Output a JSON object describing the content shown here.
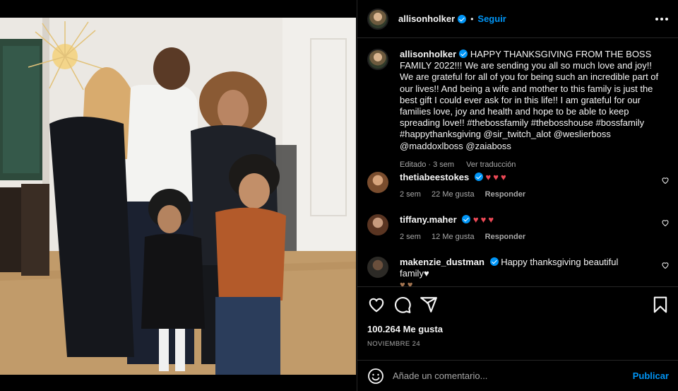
{
  "post": {
    "author": "allisonholker",
    "follow_label": "Seguir",
    "dot": "•",
    "caption": "HAPPY THANKSGIVING FROM THE BOSS FAMILY 2022!!! We are sending you all so much love and joy!! We are grateful for all of you for being such an incredible part of our lives!! And being a wife and mother to this family is just the best gift I could ever ask for in this life!! I am grateful for our families love, joy and health and hope to be able to keep spreading love!! #thebossfamily #thebosshouse #bossfamily #happythanksgiving @sir_twitch_alot @weslierboss @maddoxlboss @zaiaboss",
    "edited": "Editado · 3 sem",
    "translate": "Ver traducción",
    "likes": "100.264 Me gusta",
    "date": "NOVIEMBRE 24"
  },
  "comments": [
    {
      "user": "thetiabeestokes",
      "verified": true,
      "text": "♥♥♥",
      "time": "2 sem",
      "likes": "22 Me gusta",
      "reply": "Responder"
    },
    {
      "user": "tiffany.maher",
      "verified": true,
      "text": "♥♥♥",
      "time": "2 sem",
      "likes": "12 Me gusta",
      "reply": "Responder"
    },
    {
      "user": "makenzie_dustman",
      "verified": true,
      "text": "Happy thanksgiving beautiful family♥",
      "extra": "♥♥"
    }
  ],
  "composer": {
    "placeholder": "Añade un comentario...",
    "publish_label": "Publicar"
  },
  "colors": {
    "accent": "#0095f6",
    "background": "#000000",
    "muted": "#a8a8a8",
    "heart_red": "#ed4956",
    "heart_brown": "#a37450"
  },
  "icons": [
    "more-options-icon",
    "like-icon",
    "comment-icon",
    "share-icon",
    "save-icon",
    "emoji-icon",
    "small-heart-icon",
    "verified-badge-icon"
  ]
}
